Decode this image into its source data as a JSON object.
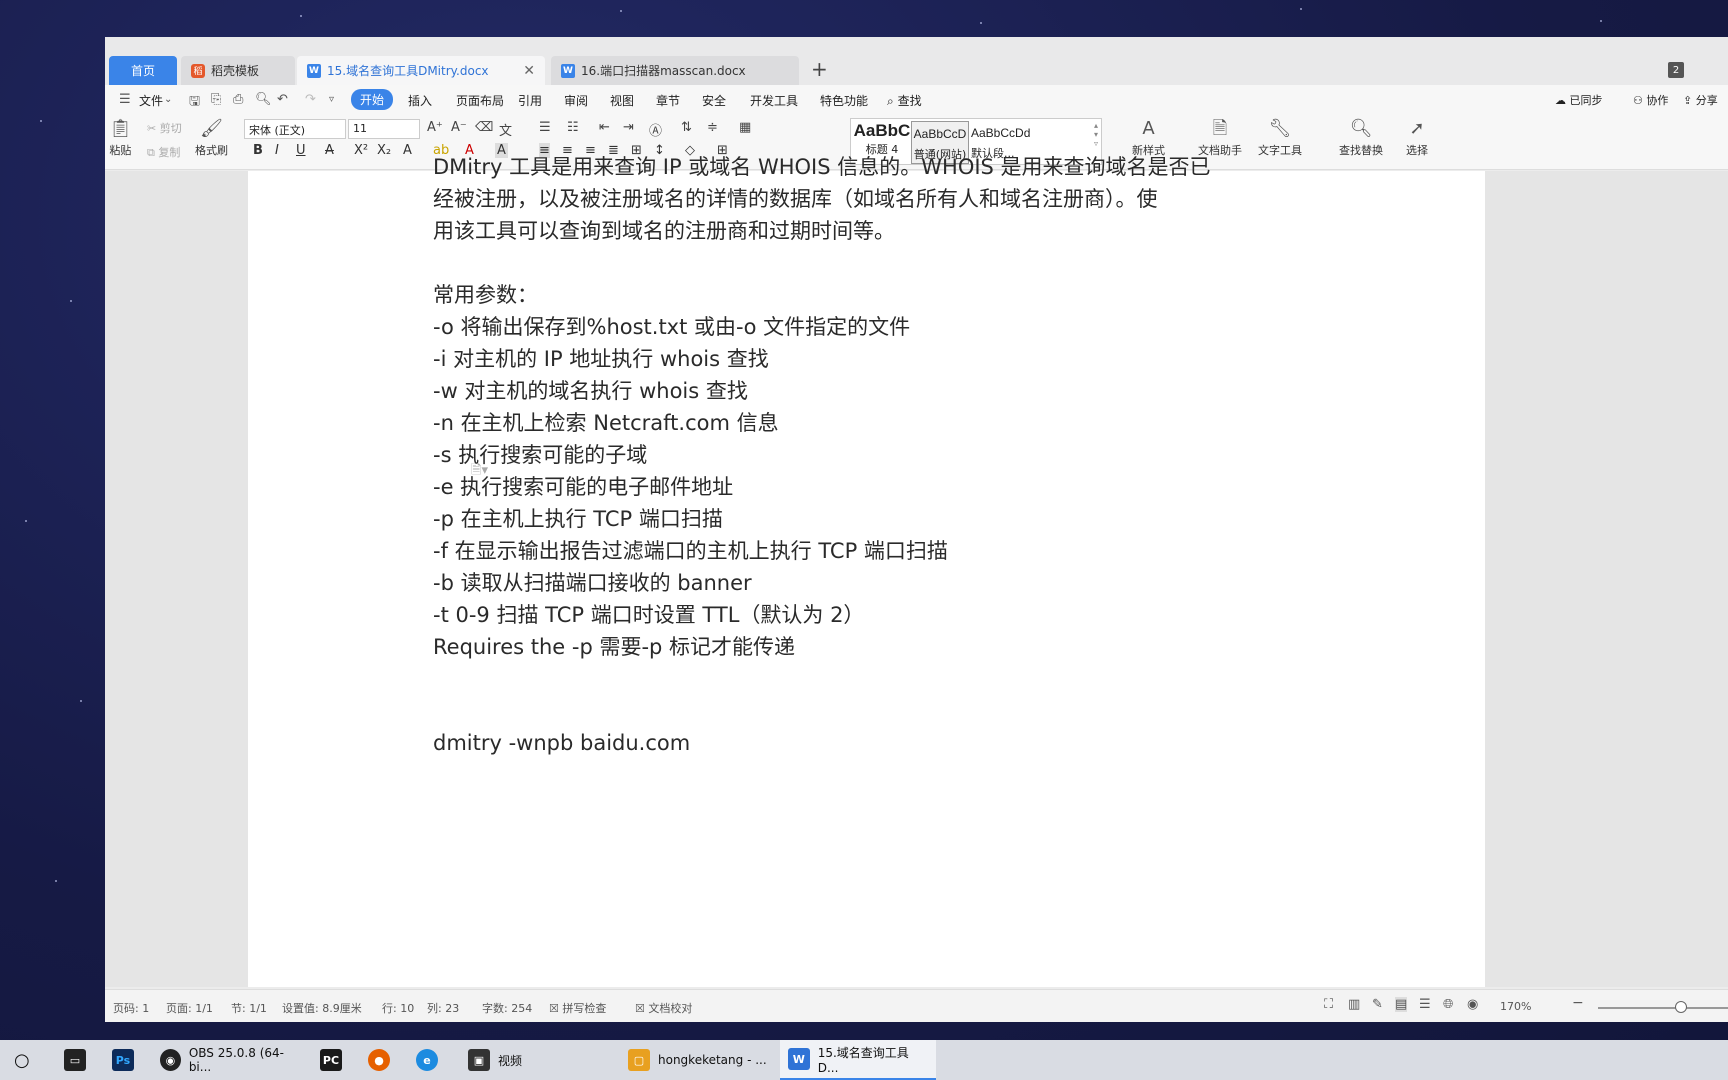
{
  "window": {
    "tabs": [
      {
        "label": "首页"
      },
      {
        "label": "稻壳模板"
      },
      {
        "label": "15.域名查询工具DMitry.docx"
      },
      {
        "label": "16.端口扫描器masscan.docx"
      }
    ],
    "tab_count_badge": "2"
  },
  "menubar": {
    "file": "文件",
    "items": [
      "开始",
      "插入",
      "页面布局",
      "引用",
      "审阅",
      "视图",
      "章节",
      "安全",
      "开发工具",
      "特色功能",
      "查找"
    ],
    "active": "开始",
    "right": [
      "已同步",
      "协作",
      "分享"
    ]
  },
  "ribbon": {
    "paste": "粘贴",
    "cut": "剪切",
    "copy": "复制",
    "format_painter": "格式刷",
    "font_name": "宋体 (正文)",
    "font_size": "11",
    "styles": [
      {
        "preview": "AaBbC",
        "label": "标题 4"
      },
      {
        "preview": "AaBbCcD",
        "label": "普通(网站)"
      },
      {
        "preview": "AaBbCcDd",
        "label": "默认段..."
      }
    ],
    "new_style": "新样式",
    "doc_assistant": "文档助手",
    "text_tools": "文字工具",
    "find_replace": "查找替换",
    "select": "选择"
  },
  "document": {
    "intro_lines": [
      "DMitry 工具是用来查询 IP 或域名 WHOIS 信息的。WHOIS 是用来查询域名是否已",
      "经被注册，以及被注册域名的详情的数据库（如域名所有人和域名注册商）。使",
      "用该工具可以查询到域名的注册商和过期时间等。"
    ],
    "params_title": "常用参数：",
    "params": [
      "-o  将输出保存到%host.txt 或由-o 文件指定的文件",
      "-i  对主机的 IP 地址执行 whois 查找",
      "-w  对主机的域名执行 whois 查找",
      "-n  在主机上检索 Netcraft.com 信息",
      "-s  执行搜索可能的子域",
      "-e  执行搜索可能的电子邮件地址",
      "-p  在主机上执行 TCP 端口扫描",
      "-f  在显示输出报告过滤端口的主机上执行 TCP 端口扫描",
      "-b  读取从扫描端口接收的 banner",
      "-t 0-9 扫描 TCP 端口时设置 TTL（默认为 2）",
      "Requires the -p  需要-p 标记才能传递"
    ],
    "command": "dmitry -wnpb baidu.com"
  },
  "statusbar": {
    "page_num": "页码: 1",
    "pages": "页面: 1/1",
    "section": "节: 1/1",
    "setting": "设置值: 8.9厘米",
    "row": "行: 10",
    "col": "列: 23",
    "words": "字数: 254",
    "spell": "拼写检查",
    "proof": "文档校对",
    "zoom": "170%"
  },
  "taskbar": [
    {
      "label": "OBS 25.0.8 (64-bi..."
    },
    {
      "label": "视频"
    },
    {
      "label": "hongkeketang - ..."
    },
    {
      "label": "15.域名查询工具D..."
    }
  ],
  "colors": {
    "accent": "#3a84e8",
    "desktop": "#1a1f4a"
  }
}
